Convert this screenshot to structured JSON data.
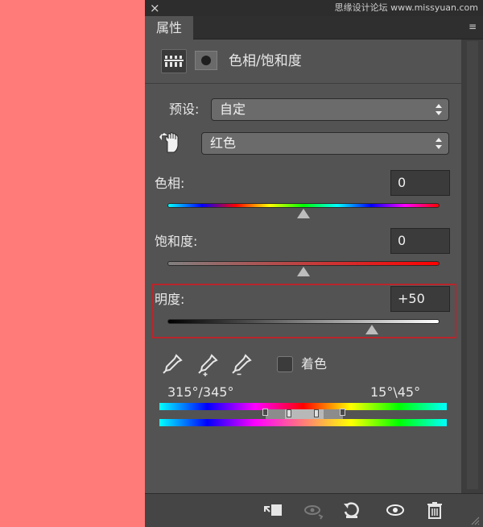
{
  "watermark": "思缘设计论坛 www.missyuan.com",
  "panel": {
    "tab": "属性",
    "close": "×",
    "menu": "≡",
    "title": "色相/饱和度"
  },
  "preset": {
    "label": "预设:",
    "value": "自定"
  },
  "channel": {
    "value": "红色"
  },
  "hue": {
    "label": "色相:",
    "value": "0",
    "level": 0
  },
  "saturation": {
    "label": "饱和度:",
    "value": "0",
    "level": 0
  },
  "lightness": {
    "label": "明度:",
    "value": "+50",
    "level": 50
  },
  "colorize": {
    "label": "着色",
    "checked": false
  },
  "range": {
    "left": "315°/345°",
    "right": "15°\\45°"
  },
  "colors": {
    "accent_highlight": "#b9252b",
    "panel_bg": "#535353",
    "canvas_preview": "#ff7b7a"
  },
  "icons": {
    "adjustment": "hue-saturation-icon",
    "mask": "mask-icon",
    "targeted": "hand-adjust-icon",
    "bottom": [
      "clip-to-layer-icon",
      "view-previous-icon",
      "reset-icon",
      "visibility-eye-icon",
      "trash-icon"
    ]
  }
}
